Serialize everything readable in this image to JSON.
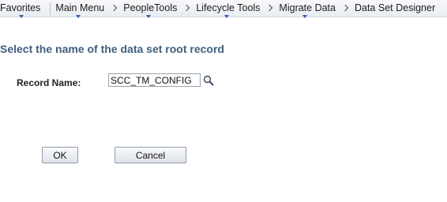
{
  "nav": {
    "favorites": "Favorites",
    "main_menu": "Main Menu",
    "peopletools": "PeopleTools",
    "lifecycle_tools": "Lifecycle Tools",
    "migrate_data": "Migrate Data",
    "data_set_designer": "Data Set Designer"
  },
  "page": {
    "title": "Select the name of the data set root record"
  },
  "form": {
    "record_label": "Record Name:",
    "record_value": "SCC_TM_CONFIG",
    "lookup_icon": "search-icon"
  },
  "buttons": {
    "ok": "OK",
    "cancel": "Cancel"
  },
  "colors": {
    "title": "#3f5e7e",
    "dropdown_marker": "#2e5fa8"
  }
}
